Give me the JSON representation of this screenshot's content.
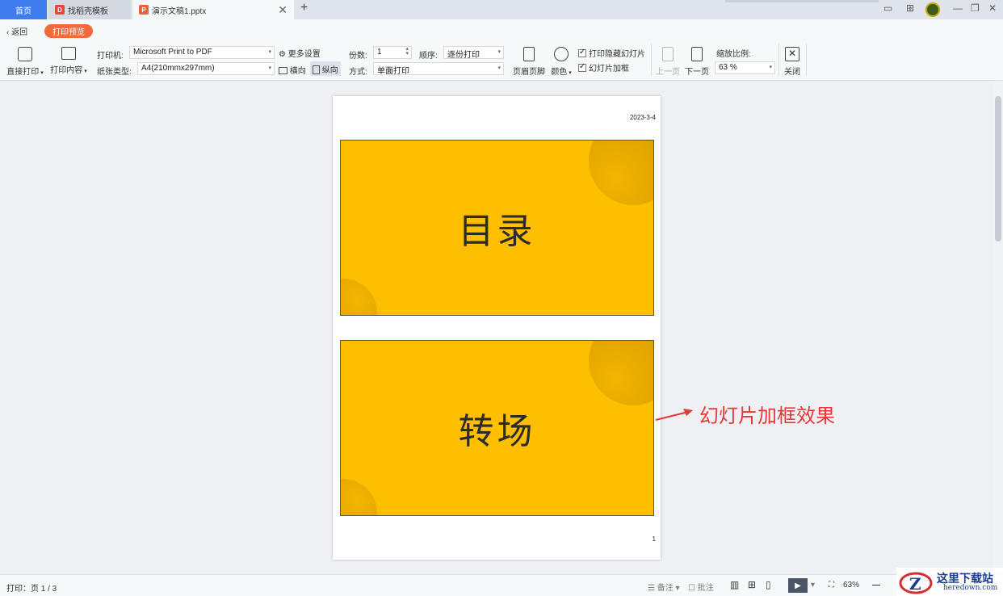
{
  "tabs": {
    "home": "首页",
    "docer": "找稻壳模板",
    "doc": "演示文稿1.pptx"
  },
  "toolbar": {
    "back": "返回",
    "preview_mode": "打印预览",
    "direct_print": "直接打印",
    "print_content": "打印内容",
    "printer_label": "打印机:",
    "printer_value": "Microsoft Print to PDF",
    "paper_label": "纸张类型:",
    "paper_value": "A4(210mmx297mm)",
    "more_settings": "更多设置",
    "landscape": "横向",
    "portrait": "纵向",
    "copies_label": "份数:",
    "copies_value": "1",
    "order_label": "顺序:",
    "order_value": "逐份打印",
    "mode_label": "方式:",
    "mode_value": "单面打印",
    "header_footer": "页眉页脚",
    "color": "颜色",
    "print_hidden": "打印隐藏幻灯片",
    "slide_frame": "幻灯片加框",
    "prev_page": "上一页",
    "next_page": "下一页",
    "zoom_label": "缩放比例:",
    "zoom_value": "63 %",
    "close": "关闭"
  },
  "page": {
    "date": "2023-3-4",
    "number": "1",
    "slides": [
      {
        "title": "目录"
      },
      {
        "title": "转场"
      }
    ]
  },
  "annotation": "幻灯片加框效果",
  "status": {
    "print_info": "打印：页 1 / 3",
    "notes": "备注",
    "comments": "批注",
    "zoom": "63%"
  },
  "watermark": {
    "title": "这里下载站",
    "url": "heredown.com"
  },
  "colors": {
    "slide_bg": "#fdbf00",
    "accent": "#f06a3c",
    "tab_active": "#3f7cf0",
    "annotation": "#e53935"
  }
}
